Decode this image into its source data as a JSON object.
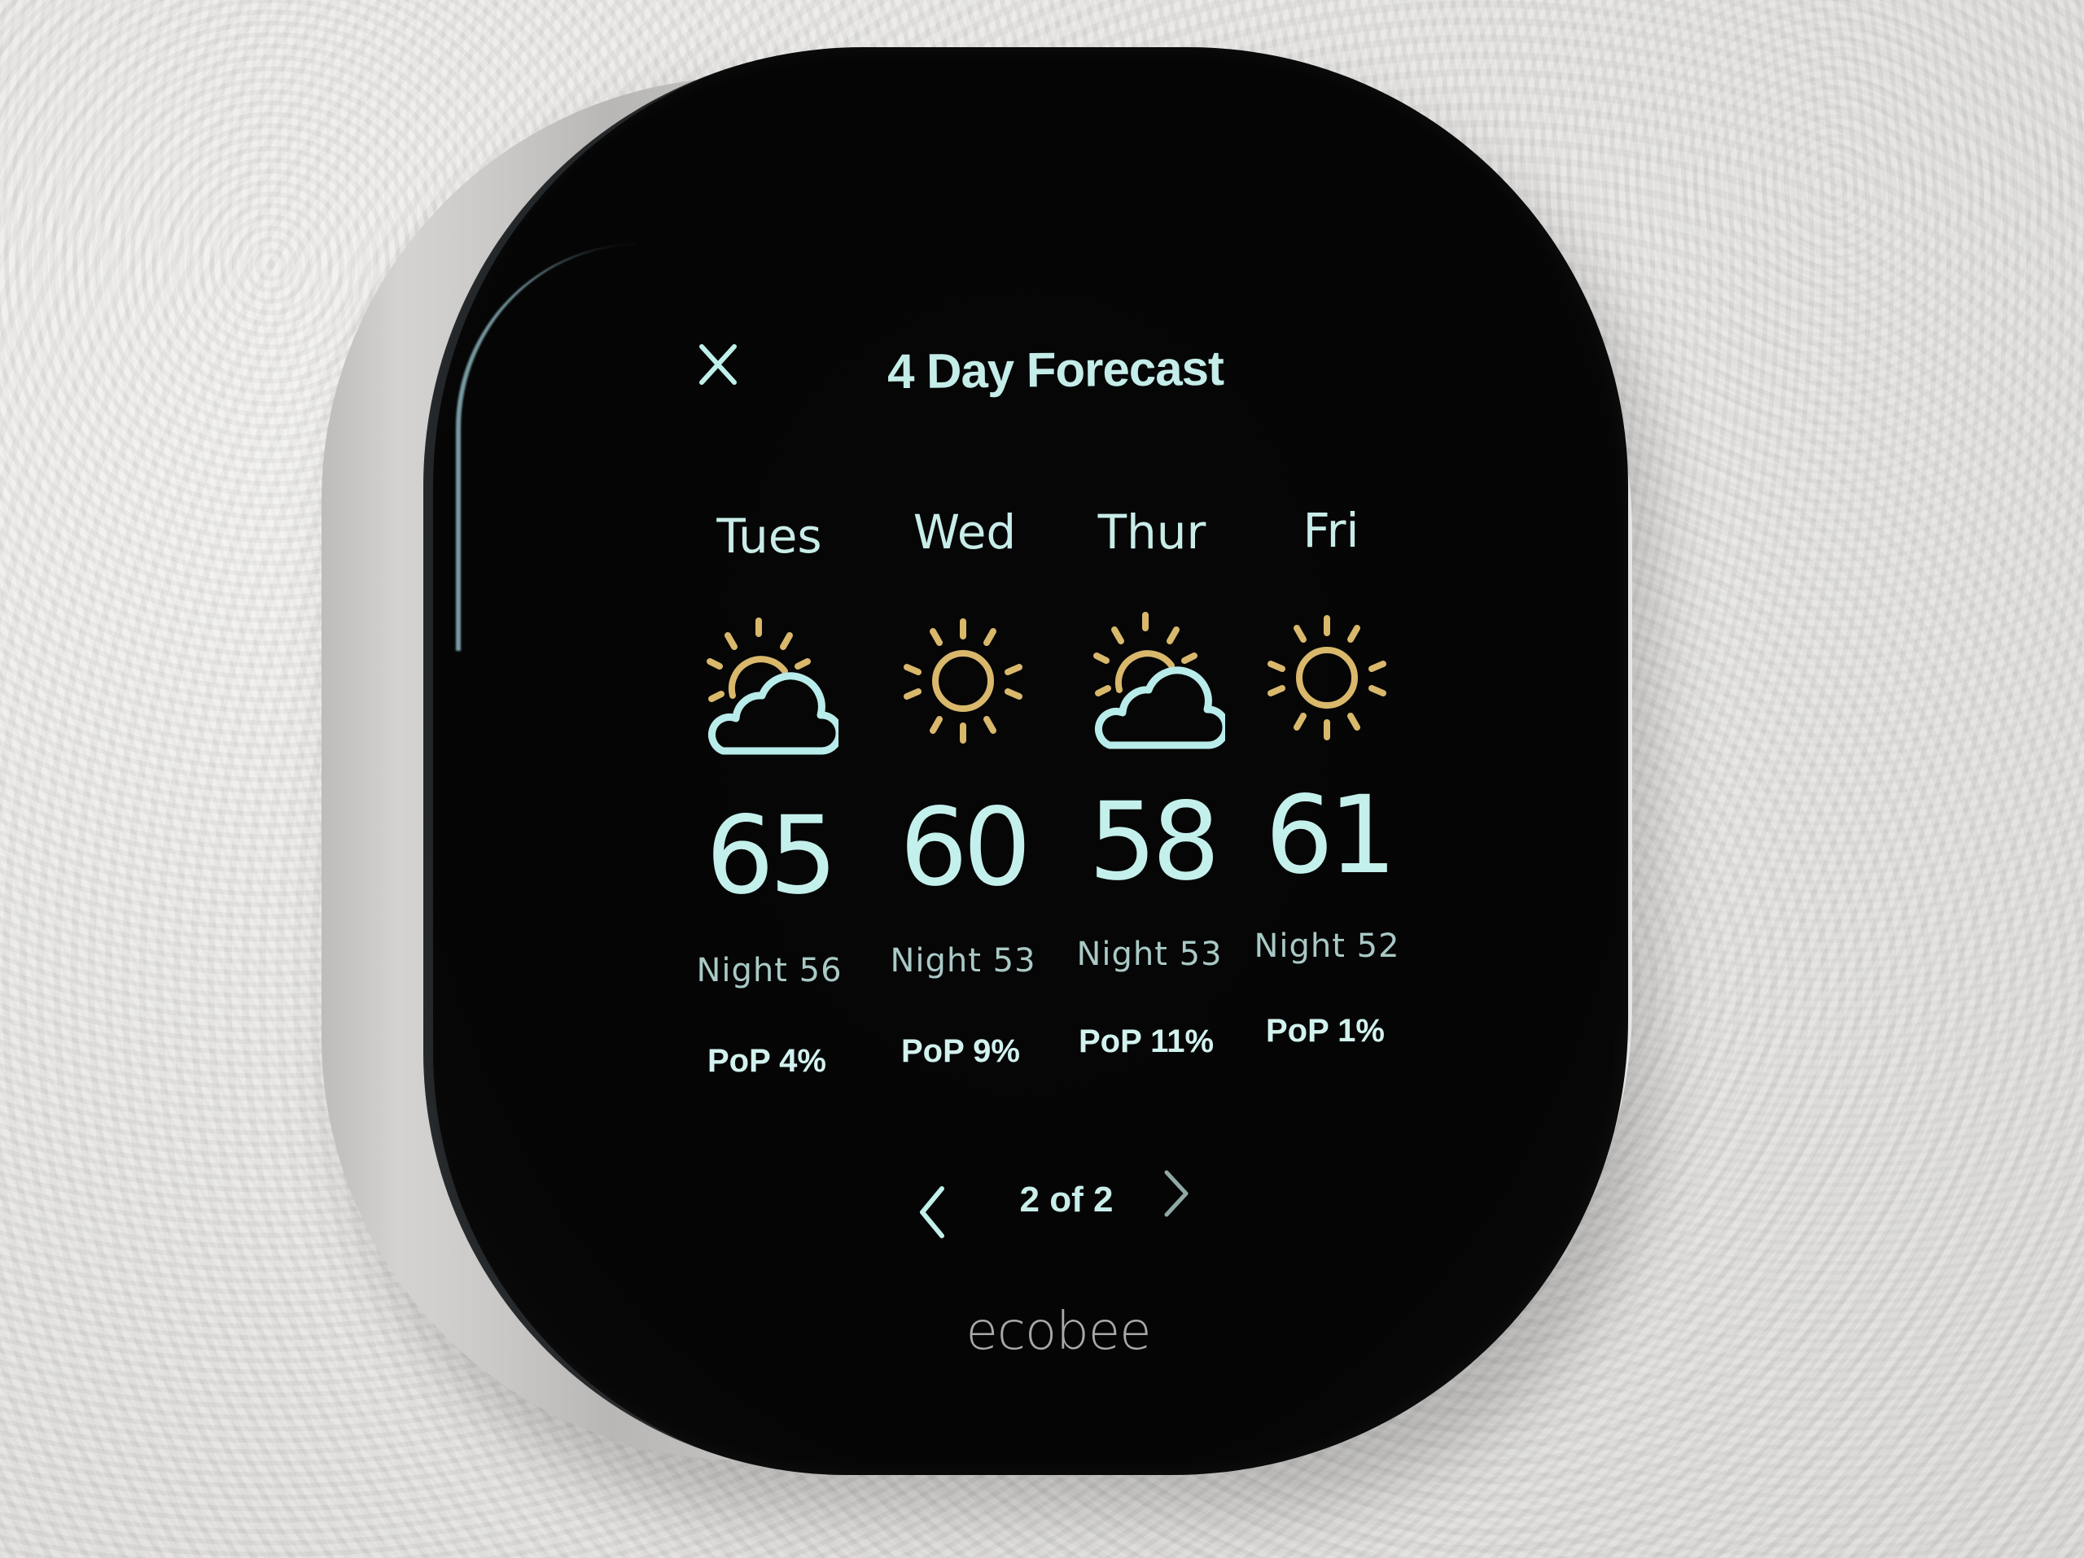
{
  "device": {
    "brand": "ecobee"
  },
  "header": {
    "title": "4 Day Forecast",
    "close_icon": "close-icon"
  },
  "forecast": [
    {
      "day": "Tues",
      "condition": "partly-cloudy",
      "icon": "partly-cloudy-icon",
      "high": "65",
      "night": "Night 56",
      "pop": "PoP 4%"
    },
    {
      "day": "Wed",
      "condition": "sunny",
      "icon": "sun-icon",
      "high": "60",
      "night": "Night 53",
      "pop": "PoP 9%"
    },
    {
      "day": "Thur",
      "condition": "partly-cloudy",
      "icon": "partly-cloudy-icon",
      "high": "58",
      "night": "Night 53",
      "pop": "PoP 11%"
    },
    {
      "day": "Fri",
      "condition": "sunny",
      "icon": "sun-icon",
      "high": "61",
      "night": "Night 52",
      "pop": "PoP 1%"
    }
  ],
  "pager": {
    "label": "2 of 2",
    "prev_icon": "chevron-left-icon",
    "next_icon": "chevron-right-icon"
  },
  "colors": {
    "text_primary": "#c4ece8",
    "sun_accent": "#d9b86c",
    "cloud": "#b8ecea",
    "screen_bg": "#050505"
  }
}
